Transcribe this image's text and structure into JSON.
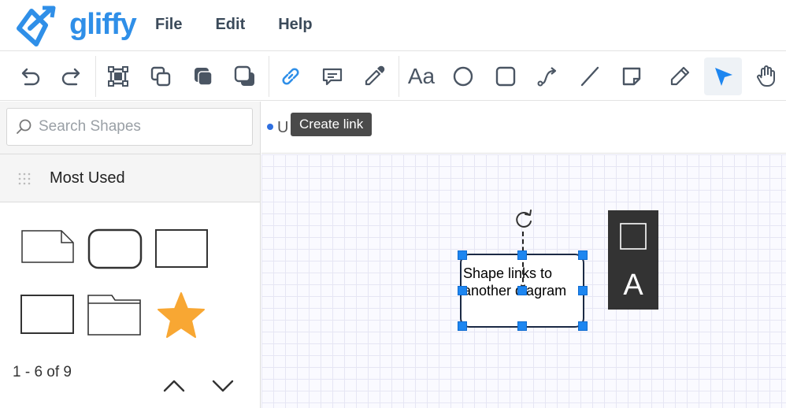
{
  "app": {
    "logo_text": "gliffy"
  },
  "menu": [
    {
      "label": "File"
    },
    {
      "label": "Edit"
    },
    {
      "label": "Help"
    }
  ],
  "toolbar": {
    "tools": [
      "undo-icon",
      "redo-icon",
      "group-icon",
      "bring-forward-icon",
      "bring-to-front-icon",
      "send-backward-icon",
      "link-icon",
      "comment-icon",
      "eyedropper-icon",
      "text-icon",
      "ellipse-icon",
      "rectangle-icon",
      "connector-icon",
      "line-icon",
      "note-icon",
      "pencil-icon",
      "pointer-icon",
      "hand-icon"
    ],
    "text_tool_label": "Aa",
    "active_tool": "pointer-icon",
    "tooltip": "Create link"
  },
  "sidebar": {
    "search": {
      "placeholder": "Search Shapes",
      "value": ""
    },
    "section_title": "Most Used",
    "shapes": [
      "note-shape",
      "rounded-rectangle-shape",
      "rectangle-shape",
      "rectangle-shape",
      "folder-shape",
      "star-shape"
    ],
    "pager": "1 - 6 of 9",
    "star_color": "#f8a733"
  },
  "canvas": {
    "ghost_text": "U",
    "shape_text_line1": "Shape links to",
    "shape_text_line2": "another diagram",
    "panel_label": "A",
    "accent": "#1d86f0"
  }
}
